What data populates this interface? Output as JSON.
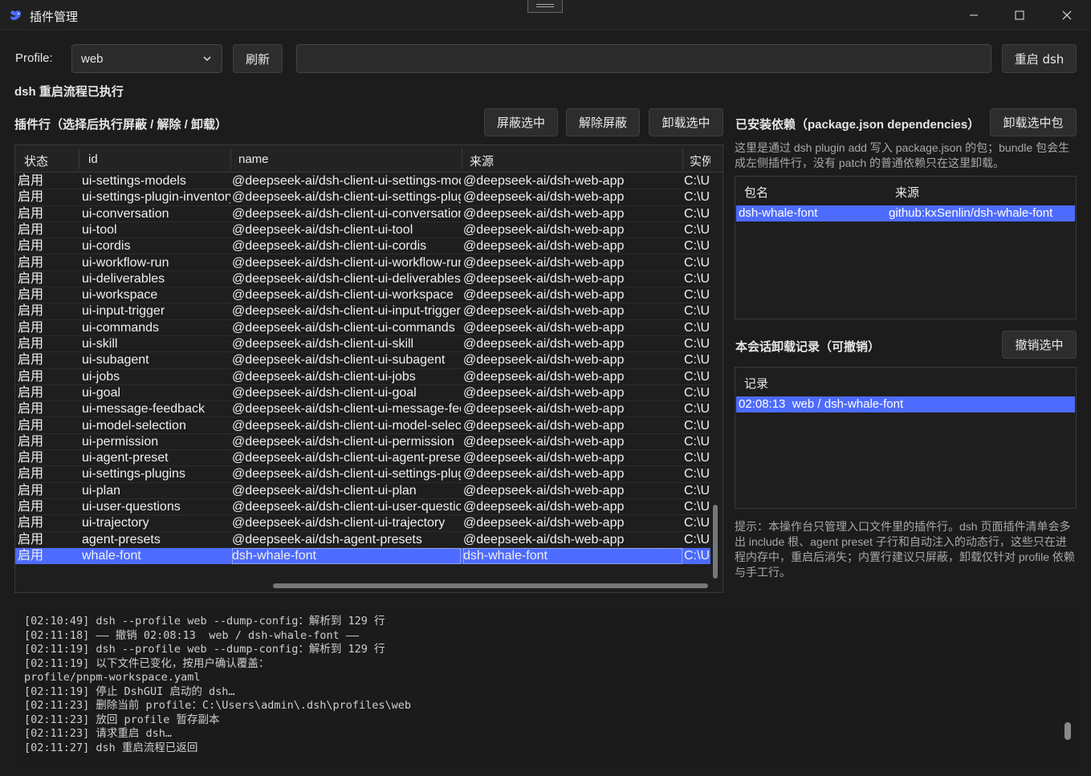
{
  "window": {
    "title": "插件管理"
  },
  "toolbar": {
    "profile_label": "Profile:",
    "profile_value": "web",
    "refresh_label": "刷新",
    "command_value": "",
    "restart_label": "重启 dsh"
  },
  "status": "dsh 重启流程已执行",
  "plugins": {
    "title": "插件行（选择后执行屏蔽 / 解除 / 卸载）",
    "block_label": "屏蔽选中",
    "unblock_label": "解除屏蔽",
    "uninstall_label": "卸载选中",
    "columns": [
      "状态",
      "id",
      "name",
      "来源",
      "实例"
    ],
    "rows": [
      {
        "state": "启用",
        "id": "ui-settings-models",
        "name": "@deepseek-ai/dsh-client-ui-settings-models",
        "source": "@deepseek-ai/dsh-web-app",
        "path": "C:\\U"
      },
      {
        "state": "启用",
        "id": "ui-settings-plugin-inventory",
        "name": "@deepseek-ai/dsh-client-ui-settings-plugin-inventory",
        "source": "@deepseek-ai/dsh-web-app",
        "path": "C:\\U"
      },
      {
        "state": "启用",
        "id": "ui-conversation",
        "name": "@deepseek-ai/dsh-client-ui-conversation",
        "source": "@deepseek-ai/dsh-web-app",
        "path": "C:\\U"
      },
      {
        "state": "启用",
        "id": "ui-tool",
        "name": "@deepseek-ai/dsh-client-ui-tool",
        "source": "@deepseek-ai/dsh-web-app",
        "path": "C:\\U"
      },
      {
        "state": "启用",
        "id": "ui-cordis",
        "name": "@deepseek-ai/dsh-client-ui-cordis",
        "source": "@deepseek-ai/dsh-web-app",
        "path": "C:\\U"
      },
      {
        "state": "启用",
        "id": "ui-workflow-run",
        "name": "@deepseek-ai/dsh-client-ui-workflow-run",
        "source": "@deepseek-ai/dsh-web-app",
        "path": "C:\\U"
      },
      {
        "state": "启用",
        "id": "ui-deliverables",
        "name": "@deepseek-ai/dsh-client-ui-deliverables",
        "source": "@deepseek-ai/dsh-web-app",
        "path": "C:\\U"
      },
      {
        "state": "启用",
        "id": "ui-workspace",
        "name": "@deepseek-ai/dsh-client-ui-workspace",
        "source": "@deepseek-ai/dsh-web-app",
        "path": "C:\\U"
      },
      {
        "state": "启用",
        "id": "ui-input-trigger",
        "name": "@deepseek-ai/dsh-client-ui-input-trigger",
        "source": "@deepseek-ai/dsh-web-app",
        "path": "C:\\U"
      },
      {
        "state": "启用",
        "id": "ui-commands",
        "name": "@deepseek-ai/dsh-client-ui-commands",
        "source": "@deepseek-ai/dsh-web-app",
        "path": "C:\\U"
      },
      {
        "state": "启用",
        "id": "ui-skill",
        "name": "@deepseek-ai/dsh-client-ui-skill",
        "source": "@deepseek-ai/dsh-web-app",
        "path": "C:\\U"
      },
      {
        "state": "启用",
        "id": "ui-subagent",
        "name": "@deepseek-ai/dsh-client-ui-subagent",
        "source": "@deepseek-ai/dsh-web-app",
        "path": "C:\\U"
      },
      {
        "state": "启用",
        "id": "ui-jobs",
        "name": "@deepseek-ai/dsh-client-ui-jobs",
        "source": "@deepseek-ai/dsh-web-app",
        "path": "C:\\U"
      },
      {
        "state": "启用",
        "id": "ui-goal",
        "name": "@deepseek-ai/dsh-client-ui-goal",
        "source": "@deepseek-ai/dsh-web-app",
        "path": "C:\\U"
      },
      {
        "state": "启用",
        "id": "ui-message-feedback",
        "name": "@deepseek-ai/dsh-client-ui-message-feedback",
        "source": "@deepseek-ai/dsh-web-app",
        "path": "C:\\U"
      },
      {
        "state": "启用",
        "id": "ui-model-selection",
        "name": "@deepseek-ai/dsh-client-ui-model-selection",
        "source": "@deepseek-ai/dsh-web-app",
        "path": "C:\\U"
      },
      {
        "state": "启用",
        "id": "ui-permission",
        "name": "@deepseek-ai/dsh-client-ui-permission",
        "source": "@deepseek-ai/dsh-web-app",
        "path": "C:\\U"
      },
      {
        "state": "启用",
        "id": "ui-agent-preset",
        "name": "@deepseek-ai/dsh-client-ui-agent-preset",
        "source": "@deepseek-ai/dsh-web-app",
        "path": "C:\\U"
      },
      {
        "state": "启用",
        "id": "ui-settings-plugins",
        "name": "@deepseek-ai/dsh-client-ui-settings-plugins",
        "source": "@deepseek-ai/dsh-web-app",
        "path": "C:\\U"
      },
      {
        "state": "启用",
        "id": "ui-plan",
        "name": "@deepseek-ai/dsh-client-ui-plan",
        "source": "@deepseek-ai/dsh-web-app",
        "path": "C:\\U"
      },
      {
        "state": "启用",
        "id": "ui-user-questions",
        "name": "@deepseek-ai/dsh-client-ui-user-questions",
        "source": "@deepseek-ai/dsh-web-app",
        "path": "C:\\U"
      },
      {
        "state": "启用",
        "id": "ui-trajectory",
        "name": "@deepseek-ai/dsh-client-ui-trajectory",
        "source": "@deepseek-ai/dsh-web-app",
        "path": "C:\\U"
      },
      {
        "state": "启用",
        "id": "agent-presets",
        "name": "@deepseek-ai/dsh-agent-presets",
        "source": "@deepseek-ai/dsh-web-app",
        "path": "C:\\U"
      },
      {
        "state": "启用",
        "id": "whale-font",
        "name": "dsh-whale-font",
        "source": "dsh-whale-font",
        "path": "C:\\U",
        "selected": true
      }
    ]
  },
  "deps": {
    "title": "已安装依赖（package.json dependencies）",
    "uninstall_label": "卸载选中包",
    "desc": "这里是通过 dsh plugin add 写入 package.json 的包；bundle 包会生成左侧插件行，没有 patch 的普通依赖只在这里卸载。",
    "columns": [
      "包名",
      "来源"
    ],
    "rows": [
      {
        "name": "dsh-whale-font",
        "source": "github:kxSenlin/dsh-whale-font"
      }
    ]
  },
  "history": {
    "title": "本会话卸载记录（可撤销）",
    "undo_label": "撤销选中",
    "column": "记录",
    "rows": [
      "02:08:13  web / dsh-whale-font"
    ]
  },
  "hint": "提示：本操作台只管理入口文件里的插件行。dsh 页面插件清单会多出 include 根、agent preset 子行和自动注入的动态行，这些只在进程内存中，重启后消失；内置行建议只屏蔽，卸载仅针对 profile 依赖与手工行。",
  "log": [
    "[02:10:49] dsh --profile web --dump-config：解析到 129 行",
    "[02:11:18] —— 撤销 02:08:13  web / dsh-whale-font ——",
    "[02:11:19] dsh --profile web --dump-config：解析到 129 行",
    "[02:11:19] 以下文件已变化，按用户确认覆盖：",
    "profile/pnpm-workspace.yaml",
    "[02:11:19] 停止 DshGUI 启动的 dsh…",
    "[02:11:23] 删除当前 profile：C:\\Users\\admin\\.dsh\\profiles\\web",
    "[02:11:23] 放回 profile 暂存副本",
    "[02:11:23] 请求重启 dsh…",
    "[02:11:27] dsh 重启流程已返回"
  ],
  "colors": {
    "accent": "#4d6bfe",
    "background": "#1c1c1c"
  }
}
